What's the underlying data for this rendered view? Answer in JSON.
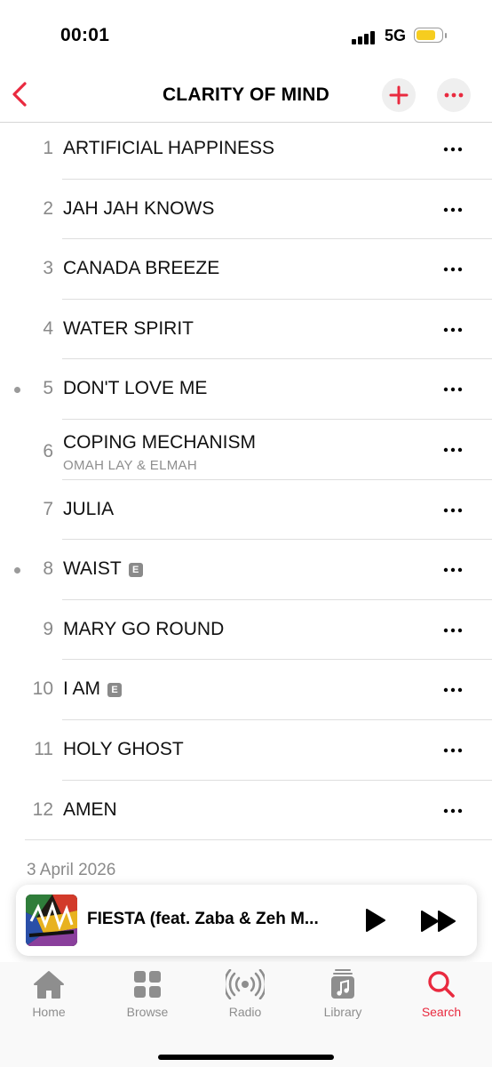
{
  "status_bar": {
    "time": "00:01",
    "network": "5G"
  },
  "header": {
    "title": "CLARITY OF MIND"
  },
  "tracks": [
    {
      "number": "1",
      "title": "ARTIFICIAL HAPPINESS"
    },
    {
      "number": "2",
      "title": "JAH JAH KNOWS"
    },
    {
      "number": "3",
      "title": "CANADA BREEZE"
    },
    {
      "number": "4",
      "title": "WATER SPIRIT"
    },
    {
      "number": "5",
      "title": "DON'T LOVE ME"
    },
    {
      "number": "6",
      "title": "COPING MECHANISM",
      "artist": "OMAH LAY & ELMAH"
    },
    {
      "number": "7",
      "title": "JULIA"
    },
    {
      "number": "8",
      "title": "WAIST",
      "explicit": "E"
    },
    {
      "number": "9",
      "title": "MARY GO ROUND"
    },
    {
      "number": "10",
      "title": "I AM",
      "explicit": "E"
    },
    {
      "number": "11",
      "title": "HOLY GHOST"
    },
    {
      "number": "12",
      "title": "AMEN"
    }
  ],
  "release_date": "3 April 2026",
  "now_playing": {
    "title": "FIESTA (feat. Zaba & Zeh M..."
  },
  "tabs": [
    {
      "label": "Home",
      "icon": "house-icon"
    },
    {
      "label": "Browse",
      "icon": "grid-icon"
    },
    {
      "label": "Radio",
      "icon": "radio-waves-icon"
    },
    {
      "label": "Library",
      "icon": "music-note-library-icon"
    },
    {
      "label": "Search",
      "icon": "magnifier-icon",
      "active": true
    }
  ],
  "colors": {
    "accent": "#e92a3f",
    "secondary_text": "#8e8e8e",
    "battery": "#f6cd1f"
  }
}
